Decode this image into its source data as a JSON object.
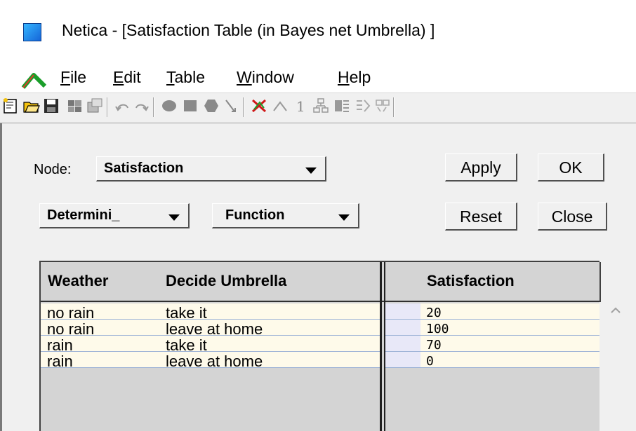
{
  "window": {
    "title": "Netica - [Satisfaction Table (in Bayes net Umbrella) ]"
  },
  "menu": {
    "items": [
      {
        "accel": "F",
        "rest": "ile"
      },
      {
        "accel": "E",
        "rest": "dit"
      },
      {
        "accel": "T",
        "rest": "able"
      },
      {
        "accel": "W",
        "rest": "indow"
      },
      {
        "accel": "H",
        "rest": "elp"
      }
    ]
  },
  "toolbar": {
    "icons": [
      "new-icon",
      "open-icon",
      "save-icon",
      "compile-icon",
      "properties-icon",
      "undo-icon",
      "redo-icon",
      "nature-node-icon",
      "decision-node-icon",
      "utility-node-icon",
      "link-icon",
      "delete-findings-icon",
      "relax-icon",
      "digit-one-icon",
      "network-icon",
      "table-icon",
      "abstract-icon",
      "learn-icon"
    ],
    "one_label": "1"
  },
  "dialog": {
    "node_label": "Node:",
    "node_value": "Satisfaction",
    "table_type": "Determini_",
    "table_view": "Function",
    "apply_label": "Apply",
    "ok_label": "OK",
    "reset_label": "Reset",
    "close_label": "Close"
  },
  "table": {
    "headers": {
      "col1": "Weather",
      "col2": "Decide Umbrella",
      "col3": "Satisfaction"
    },
    "rows": [
      {
        "weather": "no rain",
        "decide": "take it",
        "value": "20"
      },
      {
        "weather": "no rain",
        "decide": "leave at home",
        "value": "100"
      },
      {
        "weather": "rain",
        "decide": "take it",
        "value": "70"
      },
      {
        "weather": "rain",
        "decide": "leave at home",
        "value": "0"
      }
    ]
  },
  "colors": {
    "cell_bg": "#fefaea",
    "row_line": "#9cb2d6",
    "panel_bg": "#f0f0f0",
    "app_icon": "#1f8ef0"
  }
}
